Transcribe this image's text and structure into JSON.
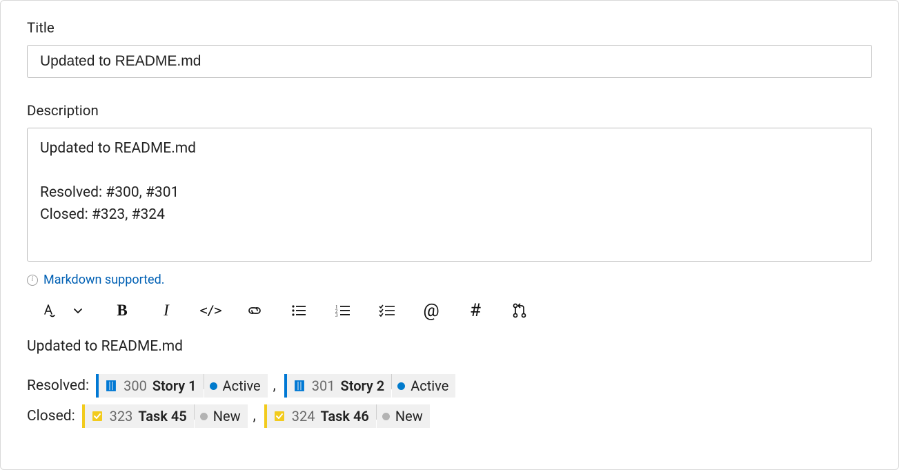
{
  "title_field": {
    "label": "Title",
    "value": "Updated to README.md"
  },
  "description_field": {
    "label": "Description",
    "value": "Updated to README.md\n\nResolved: #300, #301\nClosed: #323, #324"
  },
  "markdown_hint": {
    "text": "Markdown supported."
  },
  "toolbar": {
    "items": [
      {
        "name": "text-style",
        "label": "A"
      },
      {
        "name": "chevron",
        "label": "v"
      },
      {
        "name": "bold",
        "label": "B"
      },
      {
        "name": "italic",
        "label": "I"
      },
      {
        "name": "code",
        "label": "</>"
      },
      {
        "name": "link",
        "label": "link"
      },
      {
        "name": "bullet-list",
        "label": "bullet"
      },
      {
        "name": "number-list",
        "label": "number"
      },
      {
        "name": "checklist",
        "label": "check"
      },
      {
        "name": "mention",
        "label": "@"
      },
      {
        "name": "hashtag",
        "label": "#"
      },
      {
        "name": "pull-request",
        "label": "pr"
      }
    ]
  },
  "preview": {
    "title": "Updated to README.md",
    "groups": [
      {
        "label": "Resolved:",
        "items": [
          {
            "type": "story",
            "id": "300",
            "title": "Story 1",
            "state": "Active",
            "state_class": "active"
          },
          {
            "type": "story",
            "id": "301",
            "title": "Story 2",
            "state": "Active",
            "state_class": "active"
          }
        ]
      },
      {
        "label": "Closed:",
        "items": [
          {
            "type": "task",
            "id": "323",
            "title": "Task 45",
            "state": "New",
            "state_class": "new"
          },
          {
            "type": "task",
            "id": "324",
            "title": "Task 46",
            "state": "New",
            "state_class": "new"
          }
        ]
      }
    ]
  },
  "colors": {
    "story": "#0078d4",
    "task": "#f2cb1d",
    "active_dot": "#007acc",
    "new_dot": "#b3b3b3",
    "link": "#0060b4"
  }
}
